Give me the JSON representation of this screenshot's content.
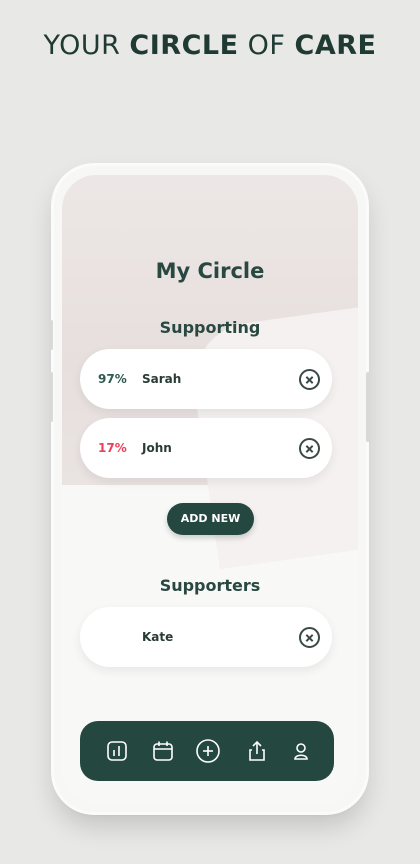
{
  "headline": {
    "part1": "YOUR ",
    "part2": "CIRCLE",
    "part3": " OF ",
    "part4": "CARE"
  },
  "screen": {
    "title": "My Circle",
    "supporting": {
      "heading": "Supporting",
      "items": [
        {
          "percent": "97%",
          "name": "Sarah",
          "percent_color": "#2f5a4f"
        },
        {
          "percent": "17%",
          "name": "John",
          "percent_color": "#e8425a"
        }
      ]
    },
    "add_new_label": "ADD NEW",
    "supporters": {
      "heading": "Supporters",
      "items": [
        {
          "name": "Kate"
        }
      ]
    }
  },
  "nav": {
    "items": [
      "stats-icon",
      "calendar-icon",
      "add-circle-icon",
      "share-icon",
      "profile-icon"
    ]
  },
  "colors": {
    "accent": "#244740",
    "text": "#284840",
    "warning": "#e8425a",
    "background": "#e8e8e7"
  }
}
